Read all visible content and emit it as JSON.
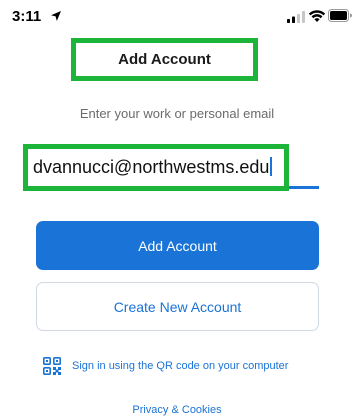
{
  "status_bar": {
    "time": "3:11",
    "icons": [
      "location-arrow-icon",
      "cellular-signal-icon",
      "wifi-icon",
      "battery-icon"
    ]
  },
  "header": {
    "title": "Add Account"
  },
  "form": {
    "instruction": "Enter your work or personal email",
    "email_value": "dvannucci@northwestms.edu"
  },
  "actions": {
    "add_account_label": "Add Account",
    "create_account_label": "Create New Account",
    "qr_label": "Sign in using the QR code on your computer",
    "qr_icon": "qr-code-icon",
    "privacy_label": "Privacy & Cookies"
  },
  "colors": {
    "accent": "#1a73d6",
    "highlight": "#1db43a"
  }
}
